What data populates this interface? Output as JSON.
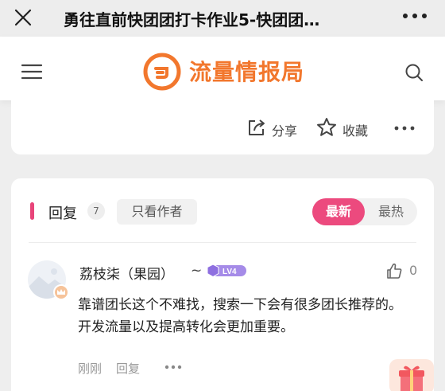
{
  "topbar": {
    "title": "勇往直前快团团打卡作业5-快团团…",
    "close_icon": "close-icon",
    "more_icon": "more-icon"
  },
  "header": {
    "logo_text": "流量情报局",
    "menu_icon": "hamburger-icon",
    "search_icon": "search-icon",
    "brand_color": "#f2772d"
  },
  "actions": {
    "share_label": "分享",
    "favorite_label": "收藏"
  },
  "comments_section": {
    "title": "回复",
    "count": "7",
    "author_only_label": "只看作者",
    "sort_options": [
      "最新",
      "最热"
    ],
    "active_sort": "最新",
    "accent_color": "#ec4a7e"
  },
  "comments": [
    {
      "username": "荔枝柒（果园）",
      "suffix": "~",
      "level": "LV4",
      "likes": "0",
      "text": "靠谱团长这个不难找，搜索一下会有很多团长推荐的。开发流量以及提高转化会更加重要。",
      "time": "刚刚",
      "reply_label": "回复"
    }
  ]
}
